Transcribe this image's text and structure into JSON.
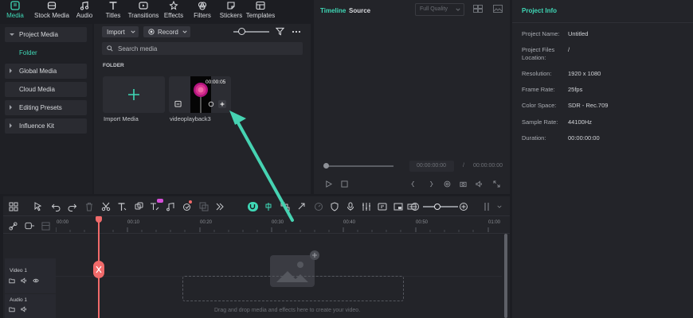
{
  "top_tabs": [
    {
      "label": "Media",
      "icon": "media-icon",
      "active": true
    },
    {
      "label": "Stock Media",
      "icon": "stock-media-icon",
      "active": false
    },
    {
      "label": "Audio",
      "icon": "audio-icon",
      "active": false
    },
    {
      "label": "Titles",
      "icon": "titles-icon",
      "active": false
    },
    {
      "label": "Transitions",
      "icon": "transitions-icon",
      "active": false
    },
    {
      "label": "Effects",
      "icon": "effects-icon",
      "active": false
    },
    {
      "label": "Filters",
      "icon": "filters-icon",
      "active": false
    },
    {
      "label": "Stickers",
      "icon": "stickers-icon",
      "active": false
    },
    {
      "label": "Templates",
      "icon": "templates-icon",
      "active": false
    }
  ],
  "sidebar": {
    "project_media": "Project Media",
    "folder": "Folder",
    "global_media": "Global Media",
    "cloud_media": "Cloud Media",
    "editing_presets": "Editing Presets",
    "influence_kit": "Influence Kit"
  },
  "media_toolbar": {
    "import": "Import",
    "record": "Record"
  },
  "search": {
    "placeholder": "Search media"
  },
  "folder_heading": "FOLDER",
  "media_items": [
    {
      "label": "Import Media"
    },
    {
      "label": "videoplayback3",
      "duration": "00:00:05"
    }
  ],
  "preview": {
    "timeline_tab": "Timeline",
    "source_tab": "Source",
    "quality": "Full Quality",
    "current_time": "00:00:00:00",
    "separator": "/",
    "total_time": "00:00:00:00"
  },
  "project_info": {
    "title": "Project Info",
    "rows": [
      {
        "key": "Project Name:",
        "value": "Untitled"
      },
      {
        "key": "Project Files Location:",
        "value": "/"
      },
      {
        "key": "Resolution:",
        "value": "1920 x 1080"
      },
      {
        "key": "Frame Rate:",
        "value": "25fps"
      },
      {
        "key": "Color Space:",
        "value": "SDR - Rec.709"
      },
      {
        "key": "Sample Rate:",
        "value": "44100Hz"
      },
      {
        "key": "Duration:",
        "value": "00:00:00:00"
      }
    ]
  },
  "timeline": {
    "ruler": [
      "00:00",
      "00:10",
      "00:20",
      "00:30",
      "00:40",
      "00:50",
      "01:00"
    ],
    "tracks": [
      {
        "label": "Video 1"
      },
      {
        "label": "Audio 1"
      }
    ],
    "drop_hint": "Drag and drop media and effects here to create your video."
  },
  "colors": {
    "accent": "#3fd8b6",
    "playhead": "#f06a6a",
    "panel": "#232429",
    "bg": "#1c1d22"
  }
}
